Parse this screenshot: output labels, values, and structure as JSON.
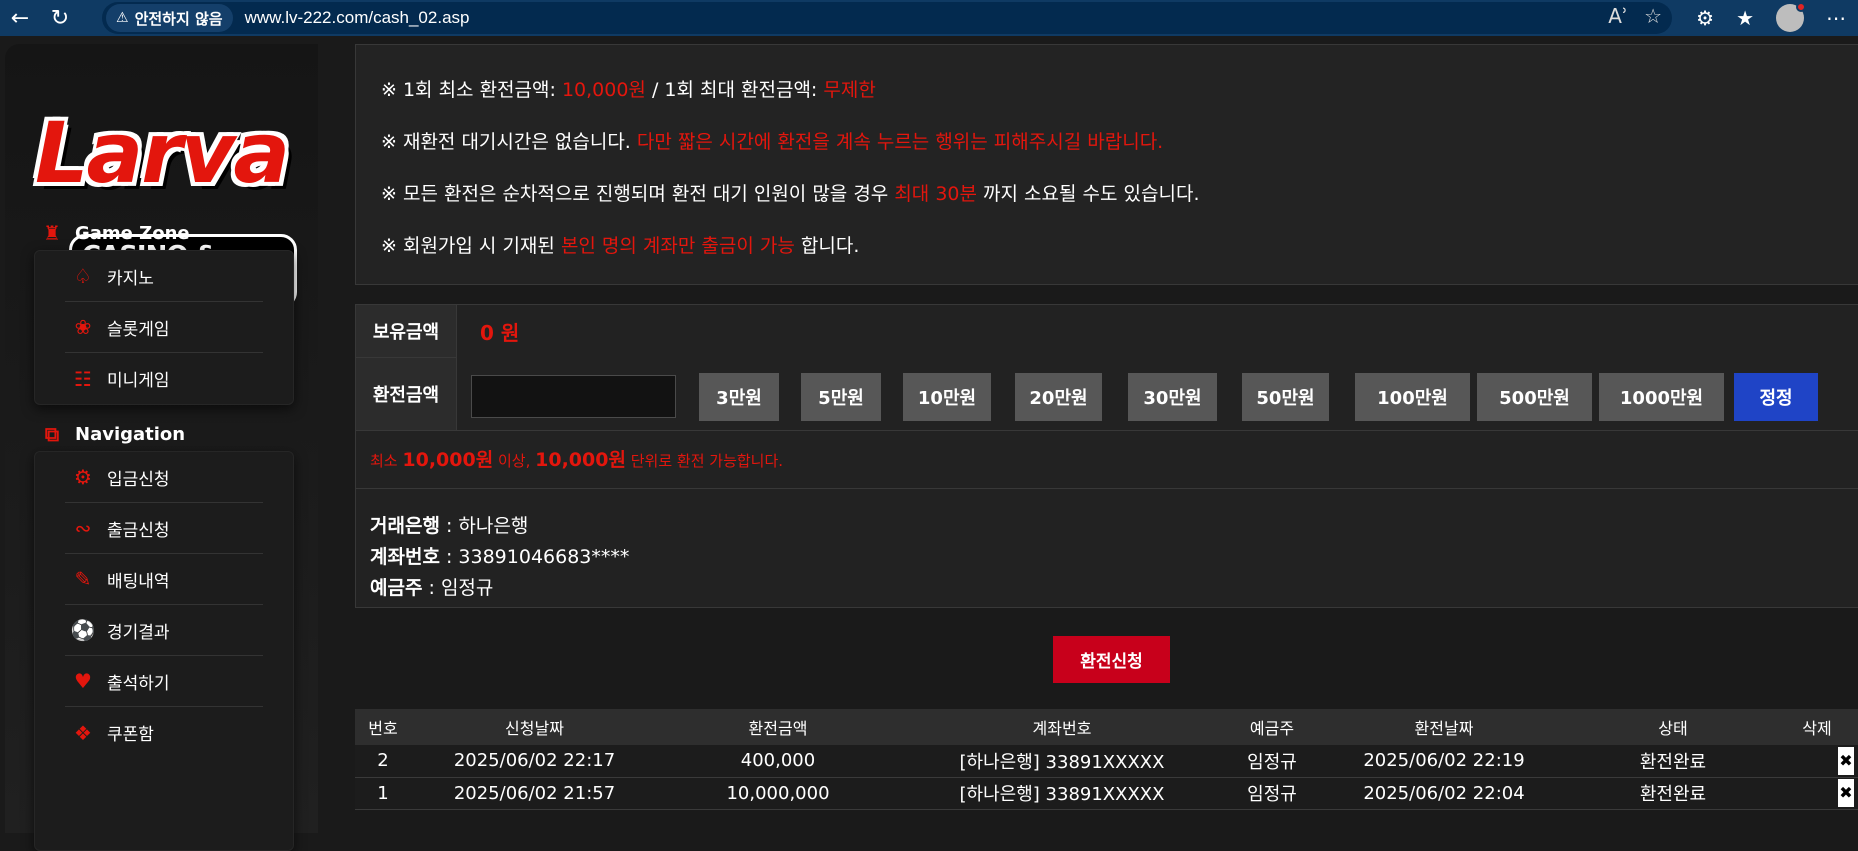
{
  "browser": {
    "security_warning": "안전하지 않음",
    "url": "www.lv-222.com/cash_02.asp"
  },
  "logo": {
    "main": "Larva",
    "sub": "CASINO & SLOT"
  },
  "sidebar": {
    "game_zone_title": "Game Zone",
    "game_items": [
      {
        "label": "카지노",
        "icon": "spade-icon"
      },
      {
        "label": "슬롯게임",
        "icon": "cherry-icon"
      },
      {
        "label": "미니게임",
        "icon": "gamepad-icon"
      }
    ],
    "navigation_title": "Navigation",
    "nav_items": [
      {
        "label": "입금신청",
        "icon": "deposit-icon"
      },
      {
        "label": "출금신청",
        "icon": "withdraw-icon"
      },
      {
        "label": "배팅내역",
        "icon": "betting-history-icon"
      },
      {
        "label": "경기결과",
        "icon": "match-result-icon"
      },
      {
        "label": "출석하기",
        "icon": "calendar-icon"
      },
      {
        "label": "쿠폰함",
        "icon": "coupon-icon"
      }
    ]
  },
  "notice": {
    "line1_a": "※ 1회 최소 환전금액:",
    "line1_b": "10,000원",
    "line1_c": "/ 1회 최대 환전금액:",
    "line1_d": "무제한",
    "line2_a": "※ 재환전 대기시간은 없습니다.",
    "line2_b": "다만 짧은 시간에 환전을 계속 누르는 행위는 피해주시길 바랍니다.",
    "line3_a": "※ 모든 환전은 순차적으로 진행되며 환전 대기 인원이 많을 경우",
    "line3_b": "최대 30분",
    "line3_c": "까지 소요될 수도 있습니다.",
    "line4_a": "※ 회원가입 시 기재된",
    "line4_b": "본인 명의 계좌만 출금이 가능",
    "line4_c": "합니다."
  },
  "form": {
    "balance_label": "보유금액",
    "balance_value": "0 원",
    "amount_label": "환전금액",
    "amount_value": "",
    "amount_buttons": [
      "3만원",
      "5만원",
      "10만원",
      "20만원",
      "30만원",
      "50만원",
      "100만원",
      "500만원",
      "1000만원"
    ],
    "reset_button": "정정",
    "min_note_a": "최소",
    "min_note_b": "10,000원",
    "min_note_c": "이상,",
    "min_note_d": "10,000원",
    "min_note_e": "단위로 환전 가능합니다.",
    "bank_label": "거래은행",
    "bank_value": ": 하나은행",
    "account_label": "계좌번호",
    "account_value": ": 33891046683****",
    "holder_label": "예금주",
    "holder_value": ": 임정규"
  },
  "apply_button": "환전신청",
  "history": {
    "headers": [
      "번호",
      "신청날짜",
      "환전금액",
      "계좌번호",
      "예금주",
      "환전날짜",
      "상태",
      "삭제"
    ],
    "rows": [
      [
        "2",
        "2025/06/02 22:17",
        "400,000",
        "[하나은행] 33891XXXXX",
        "임정규",
        "2025/06/02 22:19",
        "환전완료"
      ],
      [
        "1",
        "2025/06/02 21:57",
        "10,000,000",
        "[하나은행] 33891XXXXX",
        "임정규",
        "2025/06/02 22:04",
        "환전완료"
      ]
    ],
    "delete_glyph": "✖"
  },
  "colors": {
    "accent_red": "#e3160d",
    "apply_red": "#c8001b",
    "reset_blue": "#1f44c6"
  }
}
